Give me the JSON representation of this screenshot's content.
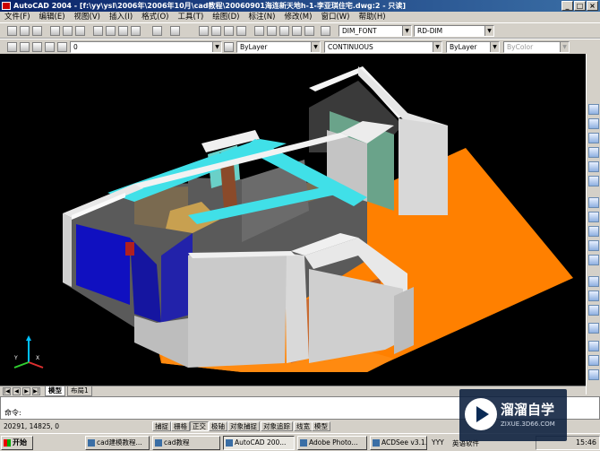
{
  "window": {
    "title": "AutoCAD 2004 - [f:\\yy\\ysl\\2006年\\2006年10月\\cad教程\\20060901海连新天地h-1-李亚琪住宅.dwg:2 - 只读]",
    "min": "_",
    "max": "□",
    "close": "×"
  },
  "menu": [
    "文件(F)",
    "编辑(E)",
    "视图(V)",
    "插入(I)",
    "格式(O)",
    "工具(T)",
    "绘图(D)",
    "标注(N)",
    "修改(M)",
    "窗口(W)",
    "帮助(H)"
  ],
  "toolbar": {
    "dimstyle": "DIM_FONT",
    "dimstyle2": "RD-DIM"
  },
  "props": {
    "layer": "0",
    "color": "ByLayer",
    "linetype": "CONTINUOUS",
    "lineweight": "ByLayer",
    "plotstyle": "ByColor"
  },
  "ucs": {
    "x": "X",
    "y": "Y"
  },
  "tabs": [
    "模型",
    "布局1"
  ],
  "command": {
    "prompt": "命令:"
  },
  "status": {
    "coords": "20291, 14825, 0",
    "buttons": [
      "捕捉",
      "栅格",
      "正交",
      "极轴",
      "对象捕捉",
      "对象追踪",
      "线宽",
      "模型"
    ]
  },
  "taskbar": {
    "start": "开始",
    "tasks": [
      "cad建模教程...",
      "cad教程",
      "AutoCAD 200...",
      "Adobe Photo...",
      "ACDSee v3.1...",
      "YYY",
      "英语软件"
    ],
    "time": "15:46"
  },
  "watermark": {
    "title": "溜溜自学",
    "url": "ZIXUE.3D66.COM"
  }
}
